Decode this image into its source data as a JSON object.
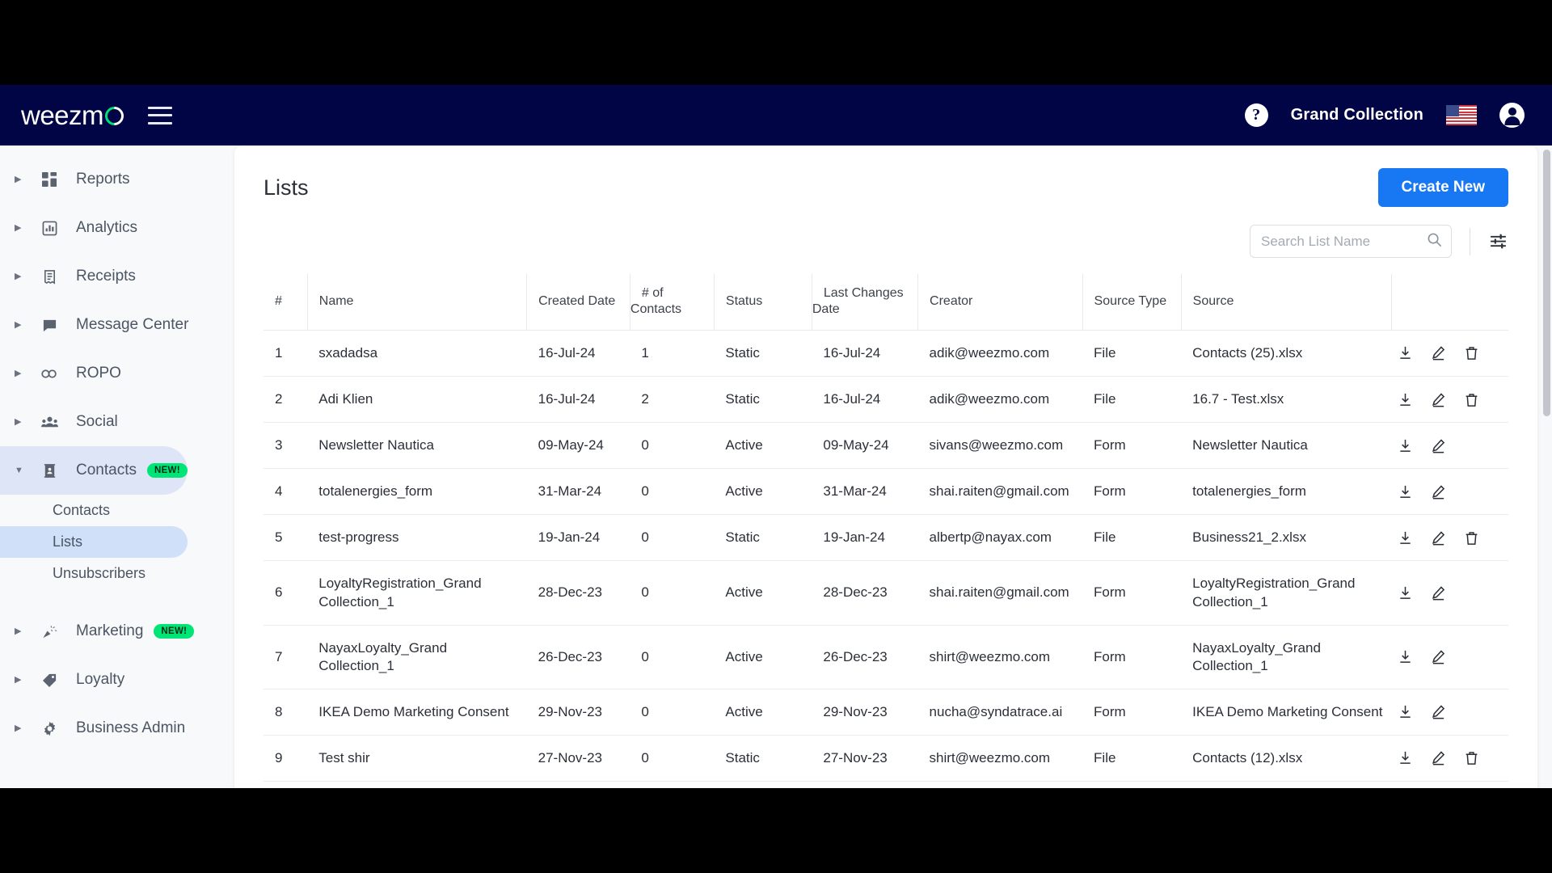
{
  "topbar": {
    "logo_text": "weezm",
    "logo_icon": "weezmo-logo",
    "menu_icon": "hamburger-menu-icon",
    "help_label": "?",
    "org_name": "Grand Collection",
    "flag_icon": "us-flag-icon",
    "account_icon": "account-avatar-icon"
  },
  "sidebar": {
    "items": [
      {
        "label": "Reports",
        "icon": "dashboard-icon",
        "badge": "",
        "expanded": false
      },
      {
        "label": "Analytics",
        "icon": "bar-chart-icon",
        "badge": "",
        "expanded": false
      },
      {
        "label": "Receipts",
        "icon": "receipt-icon",
        "badge": "",
        "expanded": false
      },
      {
        "label": "Message Center",
        "icon": "chat-bubble-icon",
        "badge": "",
        "expanded": false
      },
      {
        "label": "ROPO",
        "icon": "infinity-icon",
        "badge": "",
        "expanded": false
      },
      {
        "label": "Social",
        "icon": "people-group-icon",
        "badge": "",
        "expanded": false
      },
      {
        "label": "Contacts",
        "icon": "contact-card-icon",
        "badge": "NEW!",
        "expanded": true
      },
      {
        "label": "Marketing",
        "icon": "megaphone-icon",
        "badge": "NEW!",
        "expanded": false
      },
      {
        "label": "Loyalty",
        "icon": "tag-icon",
        "badge": "",
        "expanded": false
      },
      {
        "label": "Business Admin",
        "icon": "gear-icon",
        "badge": "",
        "expanded": false
      }
    ],
    "contacts_children": [
      {
        "label": "Contacts",
        "selected": false
      },
      {
        "label": "Lists",
        "selected": true
      },
      {
        "label": "Unsubscribers",
        "selected": false
      }
    ]
  },
  "main": {
    "title": "Lists",
    "create_button": "Create New",
    "search_placeholder": "Search List Name",
    "search_value": "",
    "search_icon": "search-icon",
    "filter_icon": "filter-sliders-icon",
    "columns": [
      "#",
      "Name",
      "Created Date",
      "# of Contacts",
      "Status",
      "Last Changes Date",
      "Creator",
      "Source Type",
      "Source",
      ""
    ],
    "rows": [
      {
        "idx": "1",
        "name": "sxadadsa",
        "created": "16-Jul-24",
        "contacts": "1",
        "status": "Static",
        "last_changes": "16-Jul-24",
        "creator": "adik@weezmo.com",
        "source_type": "File",
        "source": "Contacts (25).xlsx",
        "can_delete": true
      },
      {
        "idx": "2",
        "name": "Adi Klien",
        "created": "16-Jul-24",
        "contacts": "2",
        "status": "Static",
        "last_changes": "16-Jul-24",
        "creator": "adik@weezmo.com",
        "source_type": "File",
        "source": "16.7 - Test.xlsx",
        "can_delete": true
      },
      {
        "idx": "3",
        "name": "Newsletter Nautica",
        "created": "09-May-24",
        "contacts": "0",
        "status": "Active",
        "last_changes": "09-May-24",
        "creator": "sivans@weezmo.com",
        "source_type": "Form",
        "source": "Newsletter Nautica",
        "can_delete": false
      },
      {
        "idx": "4",
        "name": "totalenergies_form",
        "created": "31-Mar-24",
        "contacts": "0",
        "status": "Active",
        "last_changes": "31-Mar-24",
        "creator": "shai.raiten@gmail.com",
        "source_type": "Form",
        "source": "totalenergies_form",
        "can_delete": false
      },
      {
        "idx": "5",
        "name": "test-progress",
        "created": "19-Jan-24",
        "contacts": "0",
        "status": "Static",
        "last_changes": "19-Jan-24",
        "creator": "albertp@nayax.com",
        "source_type": "File",
        "source": "Business21_2.xlsx",
        "can_delete": true
      },
      {
        "idx": "6",
        "name": "LoyaltyRegistration_Grand Collection_1",
        "created": "28-Dec-23",
        "contacts": "0",
        "status": "Active",
        "last_changes": "28-Dec-23",
        "creator": "shai.raiten@gmail.com",
        "source_type": "Form",
        "source": "LoyaltyRegistration_Grand Collection_1",
        "can_delete": false
      },
      {
        "idx": "7",
        "name": "NayaxLoyalty_Grand Collection_1",
        "created": "26-Dec-23",
        "contacts": "0",
        "status": "Active",
        "last_changes": "26-Dec-23",
        "creator": "shirt@weezmo.com",
        "source_type": "Form",
        "source": "NayaxLoyalty_Grand Collection_1",
        "can_delete": false
      },
      {
        "idx": "8",
        "name": "IKEA Demo Marketing Consent",
        "created": "29-Nov-23",
        "contacts": "0",
        "status": "Active",
        "last_changes": "29-Nov-23",
        "creator": "nucha@syndatrace.ai",
        "source_type": "Form",
        "source": "IKEA Demo Marketing Consent",
        "can_delete": false
      },
      {
        "idx": "9",
        "name": "Test shir",
        "created": "27-Nov-23",
        "contacts": "0",
        "status": "Static",
        "last_changes": "27-Nov-23",
        "creator": "shirt@weezmo.com",
        "source_type": "File",
        "source": "Contacts (12).xlsx",
        "can_delete": true
      }
    ],
    "row_actions": {
      "download": "download-icon",
      "edit": "edit-pencil-icon",
      "delete": "delete-trash-icon"
    }
  },
  "colors": {
    "navy": "#020545",
    "accent_blue": "#1877f2",
    "badge_green": "#00e676",
    "selected_sub": "#cfe0f8",
    "selected_nav": "#dde5f7"
  }
}
